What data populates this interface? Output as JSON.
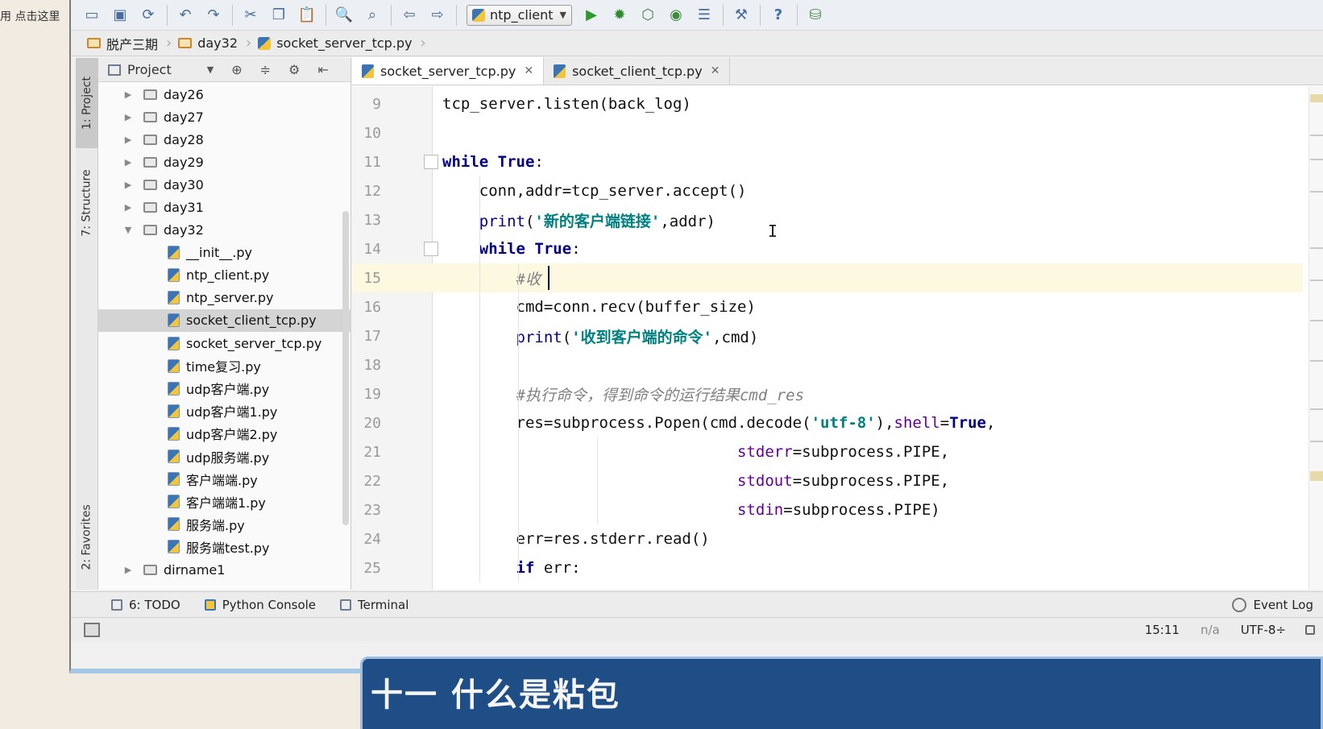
{
  "background": {
    "top_left_text": "用   点击这里"
  },
  "toolbar": {
    "run_config": "ntp_client",
    "help_icon": "?"
  },
  "breadcrumb": {
    "items": [
      "脱产三期",
      "day32",
      "socket_server_tcp.py"
    ]
  },
  "tool_strip": {
    "project": "1: Project",
    "structure": "7: Structure",
    "favorites": "2: Favorites"
  },
  "project_panel": {
    "title": "Project",
    "tree": [
      {
        "label": "day26",
        "type": "folder",
        "expanded": false
      },
      {
        "label": "day27",
        "type": "folder",
        "expanded": false
      },
      {
        "label": "day28",
        "type": "folder",
        "expanded": false
      },
      {
        "label": "day29",
        "type": "folder",
        "expanded": false
      },
      {
        "label": "day30",
        "type": "folder",
        "expanded": false
      },
      {
        "label": "day31",
        "type": "folder",
        "expanded": false
      },
      {
        "label": "day32",
        "type": "folder",
        "expanded": true
      },
      {
        "label": "__init__.py",
        "type": "file"
      },
      {
        "label": "ntp_client.py",
        "type": "file"
      },
      {
        "label": "ntp_server.py",
        "type": "file"
      },
      {
        "label": "socket_client_tcp.py",
        "type": "file",
        "selected": true
      },
      {
        "label": "socket_server_tcp.py",
        "type": "file"
      },
      {
        "label": "time复习.py",
        "type": "file"
      },
      {
        "label": "udp客户端.py",
        "type": "file"
      },
      {
        "label": "udp客户端1.py",
        "type": "file"
      },
      {
        "label": "udp客户端2.py",
        "type": "file"
      },
      {
        "label": "udp服务端.py",
        "type": "file"
      },
      {
        "label": "客户端端.py",
        "type": "file"
      },
      {
        "label": "客户端端1.py",
        "type": "file"
      },
      {
        "label": "服务端.py",
        "type": "file"
      },
      {
        "label": "服务端test.py",
        "type": "file"
      },
      {
        "label": "dirname1",
        "type": "folder",
        "expanded": false
      }
    ]
  },
  "editor": {
    "tabs": [
      {
        "label": "socket_server_tcp.py",
        "active": true
      },
      {
        "label": "socket_client_tcp.py",
        "active": false
      }
    ],
    "current_line": 15,
    "lines": [
      {
        "n": "9",
        "tokens": [
          {
            "t": "tcp_server.listen(back_log)",
            "c": ""
          }
        ]
      },
      {
        "n": "10",
        "tokens": []
      },
      {
        "n": "11",
        "tokens": [
          {
            "t": "while",
            "c": "kw"
          },
          {
            "t": " ",
            "c": ""
          },
          {
            "t": "True",
            "c": "kw"
          },
          {
            "t": ":",
            "c": ""
          }
        ]
      },
      {
        "n": "12",
        "tokens": [
          {
            "t": "    conn,addr=tcp_server.accept()",
            "c": ""
          }
        ]
      },
      {
        "n": "13",
        "tokens": [
          {
            "t": "    ",
            "c": ""
          },
          {
            "t": "print",
            "c": "bi"
          },
          {
            "t": "(",
            "c": ""
          },
          {
            "t": "'新的客户端链接'",
            "c": "str"
          },
          {
            "t": ",addr)",
            "c": ""
          }
        ]
      },
      {
        "n": "14",
        "tokens": [
          {
            "t": "    ",
            "c": ""
          },
          {
            "t": "while",
            "c": "kw"
          },
          {
            "t": " ",
            "c": ""
          },
          {
            "t": "True",
            "c": "kw"
          },
          {
            "t": ":",
            "c": ""
          }
        ]
      },
      {
        "n": "15",
        "tokens": [
          {
            "t": "        ",
            "c": ""
          },
          {
            "t": "#收",
            "c": "cm"
          }
        ]
      },
      {
        "n": "16",
        "tokens": [
          {
            "t": "        cmd=conn.recv(buffer_size)",
            "c": ""
          }
        ]
      },
      {
        "n": "17",
        "tokens": [
          {
            "t": "        ",
            "c": ""
          },
          {
            "t": "print",
            "c": "bi"
          },
          {
            "t": "(",
            "c": ""
          },
          {
            "t": "'收到客户端的命令'",
            "c": "str"
          },
          {
            "t": ",cmd)",
            "c": ""
          }
        ]
      },
      {
        "n": "18",
        "tokens": []
      },
      {
        "n": "19",
        "tokens": [
          {
            "t": "        ",
            "c": ""
          },
          {
            "t": "#执行命令，得到命令的运行结果cmd_res",
            "c": "cm"
          }
        ]
      },
      {
        "n": "20",
        "tokens": [
          {
            "t": "        res=subprocess.Popen(cmd.decode(",
            "c": ""
          },
          {
            "t": "'utf-8'",
            "c": "str"
          },
          {
            "t": "),",
            "c": ""
          },
          {
            "t": "shell",
            "c": "kwarg"
          },
          {
            "t": "=",
            "c": ""
          },
          {
            "t": "True",
            "c": "kw"
          },
          {
            "t": ",",
            "c": ""
          }
        ]
      },
      {
        "n": "21",
        "tokens": [
          {
            "t": "                                ",
            "c": ""
          },
          {
            "t": "stderr",
            "c": "kwarg"
          },
          {
            "t": "=subprocess.PIPE,",
            "c": ""
          }
        ]
      },
      {
        "n": "22",
        "tokens": [
          {
            "t": "                                ",
            "c": ""
          },
          {
            "t": "stdout",
            "c": "kwarg"
          },
          {
            "t": "=subprocess.PIPE,",
            "c": ""
          }
        ]
      },
      {
        "n": "23",
        "tokens": [
          {
            "t": "                                ",
            "c": ""
          },
          {
            "t": "stdin",
            "c": "kwarg"
          },
          {
            "t": "=subprocess.PIPE)",
            "c": ""
          }
        ]
      },
      {
        "n": "24",
        "tokens": [
          {
            "t": "        err=res.stderr.read()",
            "c": ""
          }
        ]
      },
      {
        "n": "25",
        "tokens": [
          {
            "t": "        ",
            "c": ""
          },
          {
            "t": "if",
            "c": "kw"
          },
          {
            "t": " err:",
            "c": ""
          }
        ]
      }
    ]
  },
  "bottom_bar": {
    "todo": "6: TODO",
    "python_console": "Python Console",
    "terminal": "Terminal",
    "event_log": "Event Log"
  },
  "status_bar": {
    "position": "15:11",
    "na": "n/a",
    "encoding": "UTF-8÷"
  },
  "banner": {
    "title": "十一 什么是粘包"
  }
}
